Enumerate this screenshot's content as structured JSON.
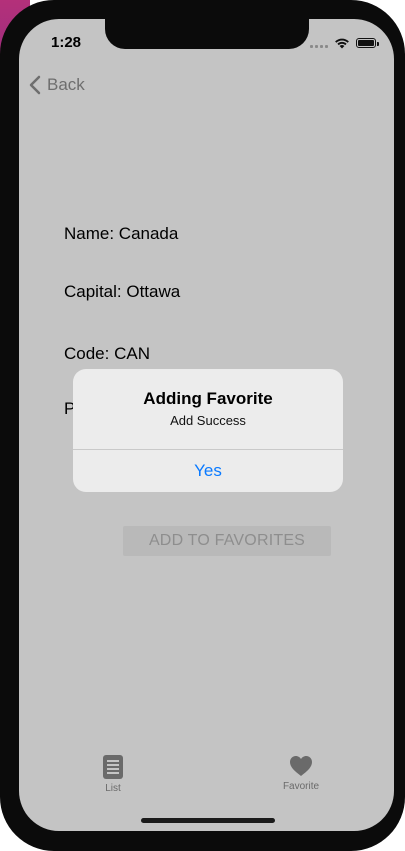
{
  "status_bar": {
    "time": "1:28",
    "icons": [
      "cellular-signal-icon",
      "wifi-icon",
      "battery-icon"
    ]
  },
  "nav": {
    "back_label": "Back",
    "back_icon": "chevron-left-icon"
  },
  "country": {
    "name": "Name: Canada",
    "capital": "Capital: Ottawa",
    "code": "Code: CAN",
    "partially_hidden_field": "P"
  },
  "actions": {
    "add_to_favorites_label": "ADD TO FAVORITES"
  },
  "alert": {
    "title": "Adding Favorite",
    "message": "Add Success",
    "confirm_label": "Yes"
  },
  "tab_bar": {
    "tabs": [
      {
        "label": "List",
        "icon": "list-icon"
      },
      {
        "label": "Favorite",
        "icon": "heart-icon"
      }
    ]
  },
  "colors": {
    "accent": "#0a7aff",
    "dimmed_background": "#c4c4c4",
    "alert_background": "#ececec"
  }
}
